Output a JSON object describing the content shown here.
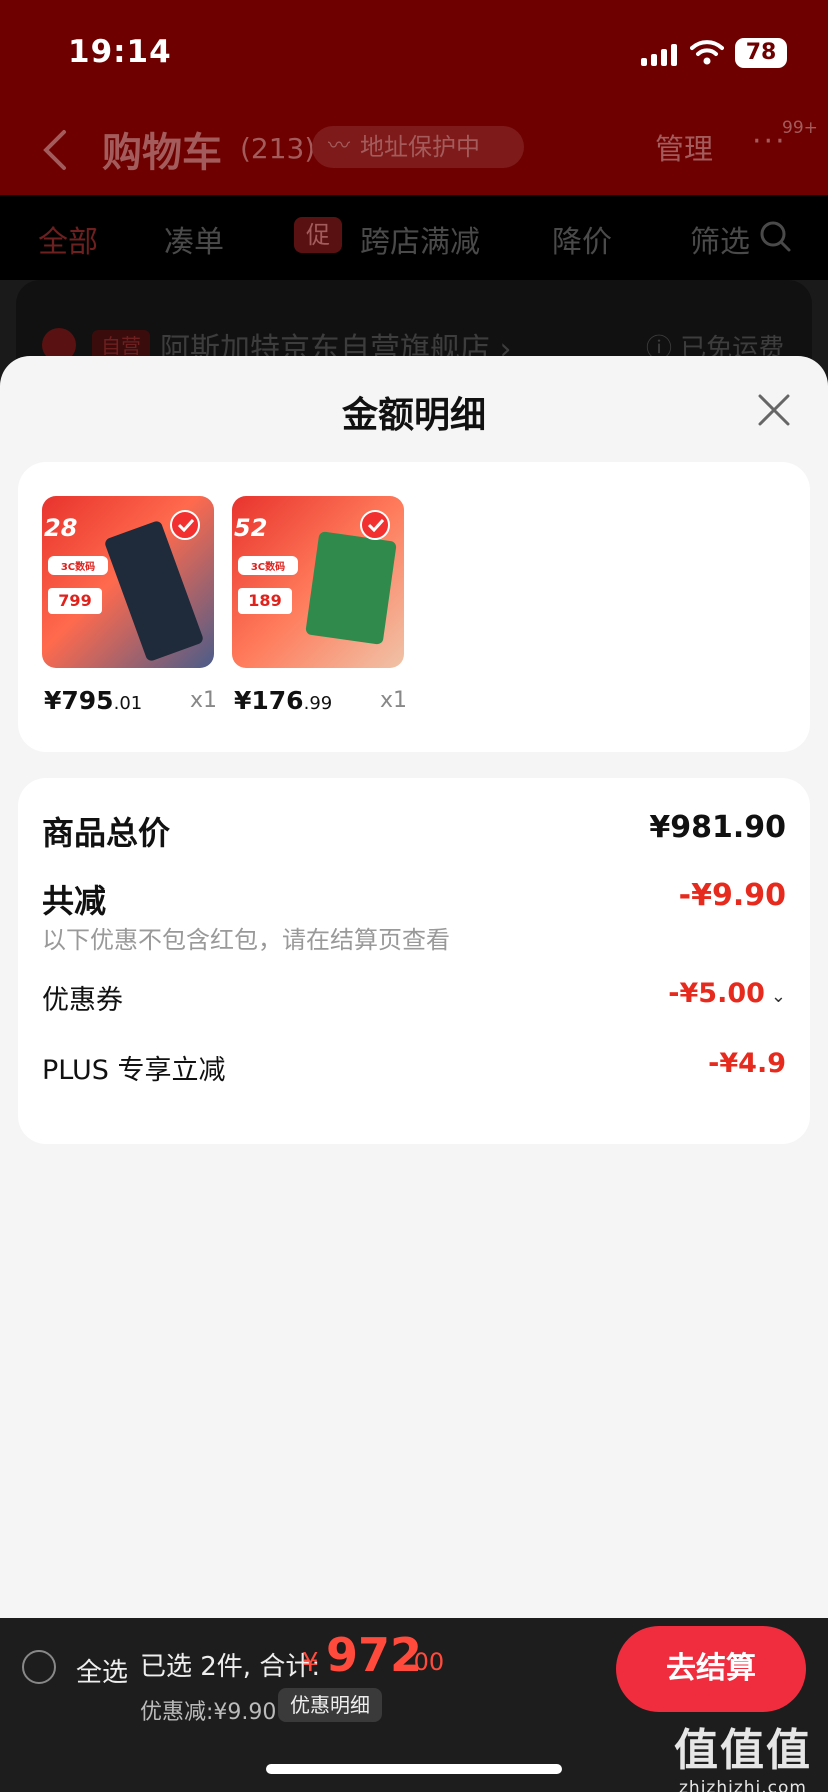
{
  "status_bar": {
    "time": "19:14",
    "battery": "78"
  },
  "header": {
    "title": "购物车",
    "count": "(213)",
    "address_protect": "地址保护中",
    "manage": "管理",
    "more_badge": "99+"
  },
  "filters": [
    {
      "label": "全部",
      "active": true
    },
    {
      "label": "凑单"
    },
    {
      "label": "跨店满减",
      "tag": "促"
    },
    {
      "label": "降价"
    },
    {
      "label": "筛选"
    }
  ],
  "store": {
    "tag": "自营",
    "name": "阿斯加特京东自营旗舰店 ›",
    "shipping": "ⓘ 已免运费"
  },
  "sheet": {
    "title": "金额明细",
    "products": [
      {
        "price_int": "¥795",
        "price_dec": ".01",
        "qty": "x1",
        "badge": "28",
        "tag": "3C数码",
        "promo_price": "799",
        "colors": [
          "#e8332d",
          "#4a5c8a"
        ]
      },
      {
        "price_int": "¥176",
        "price_dec": ".99",
        "qty": "x1",
        "badge": "52",
        "tag": "3C数码",
        "promo_price": "189",
        "colors": [
          "#e8332d",
          "#2f8a4c"
        ]
      }
    ],
    "summary": {
      "total_label": "商品总价",
      "total_value": "¥981.90",
      "reduce_label": "共减",
      "reduce_value": "-¥9.90",
      "reduce_note": "以下优惠不包含红包，请在结算页查看",
      "coupon_label": "优惠券",
      "coupon_value": "-¥5.00",
      "plus_label": "PLUS 专享立减",
      "plus_value": "-¥4.9"
    }
  },
  "bottom_bar": {
    "select_all": "全选",
    "selected": "已选 2件, 合计:",
    "total_symbol": "¥",
    "total_int": "972",
    "total_dec": ".00",
    "discount": "优惠减:¥9.90",
    "detail_button": "优惠明细",
    "checkout": "去结算"
  },
  "watermark": {
    "big": "值值值",
    "small": "zhizhizhi.com"
  },
  "colors": {
    "accent": "#ef2d3f",
    "price_red": "#e62b1e",
    "header_dark_red": "#6e0000"
  }
}
